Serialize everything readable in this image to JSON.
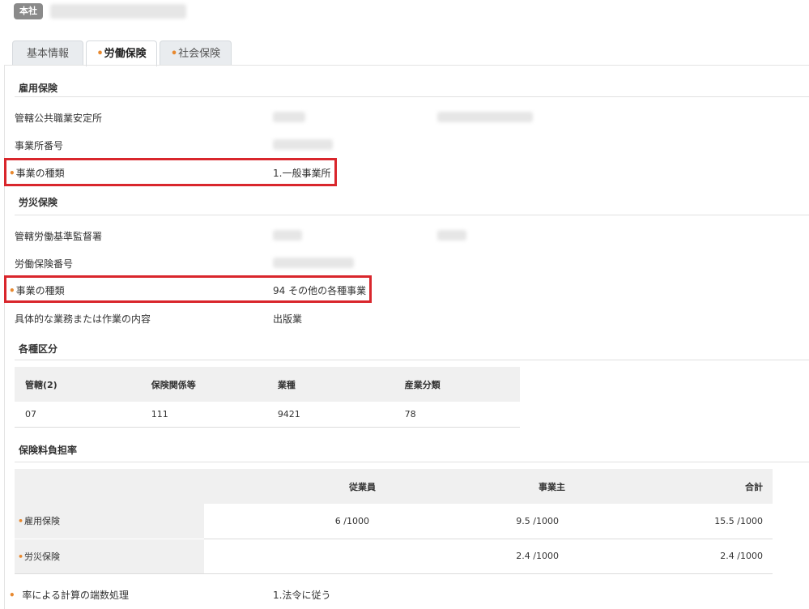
{
  "header": {
    "office_badge": "本社"
  },
  "tabs": [
    {
      "label": "基本情報",
      "dot": false
    },
    {
      "label": "労働保険",
      "dot": true
    },
    {
      "label": "社会保険",
      "dot": true
    }
  ],
  "employment": {
    "title": "雇用保険",
    "office_label": "管轄公共職業安定所",
    "number_label": "事業所番号",
    "type_label": "事業の種類",
    "type_value": "1.一般事業所"
  },
  "workers_comp": {
    "title": "労災保険",
    "office_label": "管轄労働基準監督署",
    "number_label": "労働保険番号",
    "type_label": "事業の種類",
    "type_value": "94 その他の各種事業",
    "detail_label": "具体的な業務または作業の内容",
    "detail_value": "出版業"
  },
  "categories": {
    "title": "各種区分",
    "headers": [
      "管轄(2)",
      "保険関係等",
      "業種",
      "産業分類"
    ],
    "row": [
      "07",
      "111",
      "9421",
      "78"
    ]
  },
  "rates": {
    "title": "保険料負担率",
    "headers": [
      "",
      "従業員",
      "事業主",
      "合計"
    ],
    "rows": [
      {
        "label": "雇用保険",
        "employee": "6 /1000",
        "employer": "9.5 /1000",
        "total": "15.5 /1000"
      },
      {
        "label": "労災保険",
        "employee": "",
        "employer": "2.4 /1000",
        "total": "2.4 /1000"
      }
    ]
  },
  "rounding": {
    "label": "率による計算の端数処理",
    "value": "1.法令に従う"
  },
  "colors": {
    "accent_dot": "#e8892f",
    "highlight": "#d9262c",
    "badge_bg": "#8a8a8a"
  }
}
